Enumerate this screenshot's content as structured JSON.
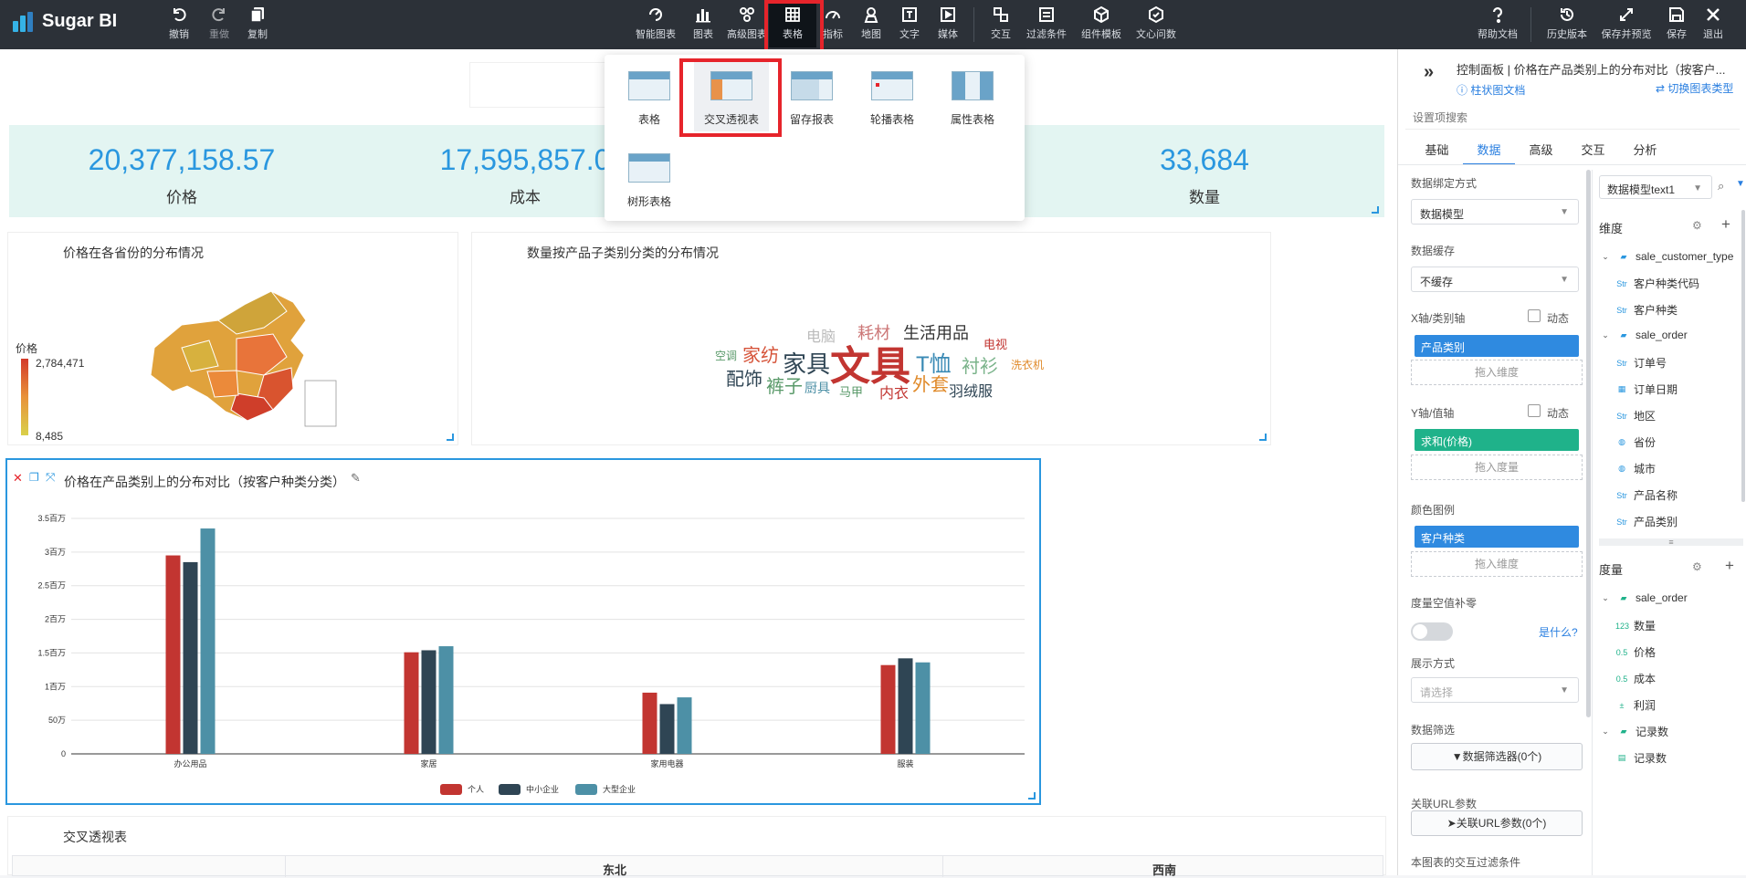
{
  "app": {
    "name": "Sugar BI"
  },
  "toolbar": {
    "undo": "撤销",
    "redo": "重做",
    "copy": "复制",
    "smart_chart": "智能图表",
    "chart": "图表",
    "advanced_chart": "高级图表",
    "table": "表格",
    "metric": "指标",
    "map": "地图",
    "text": "文字",
    "media": "媒体",
    "interaction": "交互",
    "filter": "过滤条件",
    "component_template": "组件模板",
    "wenxin": "文心问数",
    "help": "帮助文档",
    "history": "历史版本",
    "save_preview": "保存并预览",
    "save": "保存",
    "exit": "退出"
  },
  "table_menu": {
    "items": [
      "表格",
      "交叉透视表",
      "留存报表",
      "轮播表格",
      "属性表格",
      "树形表格"
    ],
    "selected": "交叉透视表"
  },
  "kpis": [
    {
      "value": "20,377,158.57",
      "label": "价格"
    },
    {
      "value": "17,595,857.0",
      "label": "成本"
    },
    {
      "value": "33,684",
      "label": "数量"
    }
  ],
  "map_card": {
    "title": "价格在各省份的分布情况",
    "legend_title": "价格",
    "legend_max": "2,784,471",
    "legend_min": "8,485"
  },
  "wordcloud_card": {
    "title": "数量按产品子类别分类的分布情况",
    "words": [
      "电脑",
      "耗材",
      "生活用品",
      "空调",
      "家纺",
      "家具",
      "文具",
      "T恤",
      "电视",
      "衬衫",
      "洗衣机",
      "配饰",
      "裤子",
      "厨具",
      "马甲",
      "内衣",
      "外套",
      "羽绒服"
    ]
  },
  "bar_card": {
    "title": "价格在产品类别上的分布对比（按客户种类分类）"
  },
  "chart_data": {
    "type": "bar",
    "categories": [
      "办公用品",
      "家居",
      "家用电器",
      "服装"
    ],
    "series": [
      {
        "name": "个人",
        "values": [
          2950000,
          1510000,
          910000,
          1320000
        ],
        "color": "#c23531"
      },
      {
        "name": "中小企业",
        "values": [
          2850000,
          1540000,
          740000,
          1420000
        ],
        "color": "#2f4554"
      },
      {
        "name": "大型企业",
        "values": [
          3350000,
          1600000,
          840000,
          1360000
        ],
        "color": "#4d90a6"
      }
    ],
    "ylim": [
      0,
      3500000
    ],
    "yticks": [
      "0",
      "50万",
      "1百万",
      "1.5百万",
      "2百万",
      "2.5百万",
      "3百万",
      "3.5百万"
    ],
    "grid": true,
    "legend_position": "bottom"
  },
  "pivot_card": {
    "title": "交叉透视表",
    "headers": [
      "东北",
      "西南"
    ]
  },
  "panel": {
    "title": "控制面板 | 价格在产品类别上的分布对比（按客户...",
    "doc_link": "柱状图文档",
    "switch_link": "切换图表类型",
    "search_placeholder": "设置项搜索",
    "tabs": [
      "基础",
      "数据",
      "高级",
      "交互",
      "分析"
    ],
    "bind_label": "数据绑定方式",
    "bind_value": "数据模型",
    "cache_label": "数据缓存",
    "cache_value": "不缓存",
    "x_label": "X轴/类别轴",
    "x_pill": "产品类别",
    "drag_dim": "拖入维度",
    "dynamic": "动态",
    "y_label": "Y轴/值轴",
    "y_pill": "求和(价格)",
    "drag_measure": "拖入度量",
    "color_label": "颜色图例",
    "color_pill": "客户种类",
    "drag_dim2": "拖入维度",
    "null_label": "度量空值补零",
    "what": "是什么?",
    "display_label": "展示方式",
    "display_placeholder": "请选择",
    "filter_label": "数据筛选",
    "filter_btn": "数据筛选器(0个)",
    "url_label": "关联URL参数",
    "url_btn": "关联URL参数(0个)",
    "inter_label": "本图表的交互过滤条件",
    "model_select": "数据模型text1",
    "dim_title": "维度",
    "dims": [
      {
        "name": "sale_customer_type",
        "type": "folder"
      },
      {
        "name": "客户种类代码",
        "type": "Str"
      },
      {
        "name": "客户种类",
        "type": "Str"
      },
      {
        "name": "sale_order",
        "type": "folder"
      },
      {
        "name": "订单号",
        "type": "Str"
      },
      {
        "name": "订单日期",
        "type": "date"
      },
      {
        "name": "地区",
        "type": "Str"
      },
      {
        "name": "省份",
        "type": "geo"
      },
      {
        "name": "城市",
        "type": "geo"
      },
      {
        "name": "产品名称",
        "type": "Str"
      },
      {
        "name": "产品类别",
        "type": "Str"
      }
    ],
    "measure_title": "度量",
    "measures": [
      {
        "name": "sale_order",
        "type": "folder"
      },
      {
        "name": "数量",
        "type": "123"
      },
      {
        "name": "价格",
        "type": "0.5"
      },
      {
        "name": "成本",
        "type": "0.5"
      },
      {
        "name": "利润",
        "type": "calc"
      },
      {
        "name": "记录数",
        "type": "folder"
      },
      {
        "name": "记录数",
        "type": "rec"
      }
    ]
  }
}
